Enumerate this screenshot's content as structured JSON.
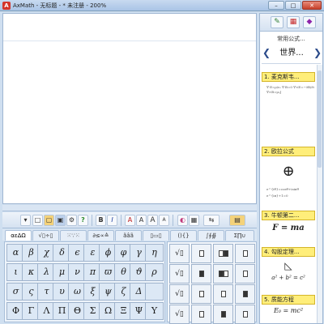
{
  "window": {
    "app_icon": "A",
    "title": "AxMath - 无标题 - * 未注册 - 200%",
    "min_label": "–",
    "max_label": "□",
    "close_label": "✕"
  },
  "toolbar": {
    "buttons": [
      "▾",
      "□",
      "▢",
      "▣",
      "⚙",
      "?",
      "B",
      "I",
      "A",
      "A",
      "A",
      "A",
      "◐",
      "▦",
      "⇆",
      "▤"
    ]
  },
  "tabs": [
    "αεΔΩ",
    "√▯÷▯",
    "⁙∵⁙",
    "∂≤∝≙",
    "ãâã",
    "▯▭▯",
    "(){}",
    "∫∮∯",
    "Σ∏∪"
  ],
  "greek": {
    "rows": [
      [
        "α",
        "β",
        "χ",
        "δ",
        "ϵ",
        "ε",
        "ϕ",
        "φ",
        "γ",
        "η"
      ],
      [
        "ι",
        "κ",
        "λ",
        "μ",
        "ν",
        "π",
        "ϖ",
        "θ",
        "ϑ",
        "ρ"
      ],
      [
        "σ",
        "ς",
        "τ",
        "υ",
        "ω",
        "ξ",
        "ψ",
        "ζ",
        "Δ",
        ""
      ],
      [
        "Φ",
        "Γ",
        "Λ",
        "Π",
        "Θ",
        "Σ",
        "Ω",
        "Ξ",
        "Ψ",
        "Υ"
      ]
    ]
  },
  "templates": {
    "rows": [
      [
        "√▯",
        "▯",
        "▯",
        "▯"
      ],
      [
        "√▯",
        "▯",
        "▯",
        "▯"
      ],
      [
        "√▯",
        "▯",
        "▯",
        "▯"
      ],
      [
        "√▯",
        "▯",
        "▯",
        "▯"
      ]
    ]
  },
  "right_panel": {
    "tool_icons": [
      "paint-palette-icon",
      "grid-icon",
      "eraser-icon"
    ],
    "title": "常用公式...",
    "nav_prev": "❮",
    "nav_next": "❯",
    "category": "世界...",
    "cards": [
      {
        "label": "1. 麦克斯韦...",
        "body": "∇·E=ρ/ε₀  ∇·B=0  ∇×E=−∂B/∂t  ∇×B=μ₀J"
      },
      {
        "label": "2. 欧拉公式",
        "body": "e^{iθ}=cosθ+isinθ",
        "body2": "e^{iπ}+1=0"
      },
      {
        "label": "3. 牛顿第二...",
        "body": "F = ma"
      },
      {
        "label": "4. 勾股定理...",
        "body": "a² + b² = c²"
      },
      {
        "label": "5. 质能方程",
        "body": "E₀ = mc²"
      }
    ]
  }
}
